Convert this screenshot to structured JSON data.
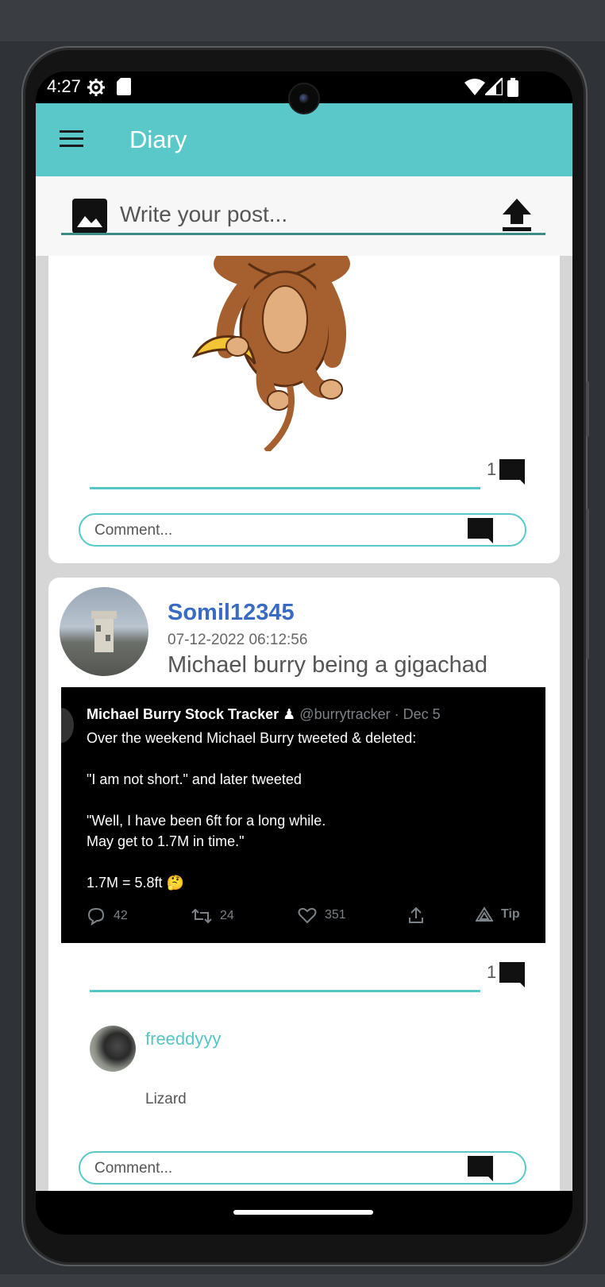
{
  "status_bar": {
    "time": "4:27"
  },
  "app_bar": {
    "title": "Diary"
  },
  "composer": {
    "placeholder": "Write your post..."
  },
  "posts": [
    {
      "comment_count": "1",
      "comment_placeholder": "Comment..."
    },
    {
      "username": "Somil12345",
      "timestamp": "07-12-2022 06:12:56",
      "caption": "Michael burry being a gigachad",
      "tweet": {
        "author": "Michael Burry Stock Tracker",
        "handle": "@burrytracker · Dec 5",
        "lines": [
          "Over the weekend Michael Burry tweeted & deleted:",
          "\"I am not short.\" and later tweeted",
          "\"Well, I have been 6ft for a long while.",
          "May get to 1.7M in time.\"",
          "1.7M = 5.8ft 🤔"
        ],
        "replies": "42",
        "retweets": "24",
        "likes": "351",
        "tip": "Tip"
      },
      "comment_count": "1",
      "comments": [
        {
          "user": "freeddyyy",
          "text": "Lizard"
        }
      ],
      "comment_placeholder": "Comment..."
    }
  ],
  "colors": {
    "accent": "#5ac8c8",
    "username": "#3a6bc4",
    "feed_bg": "#d6d6d6"
  }
}
